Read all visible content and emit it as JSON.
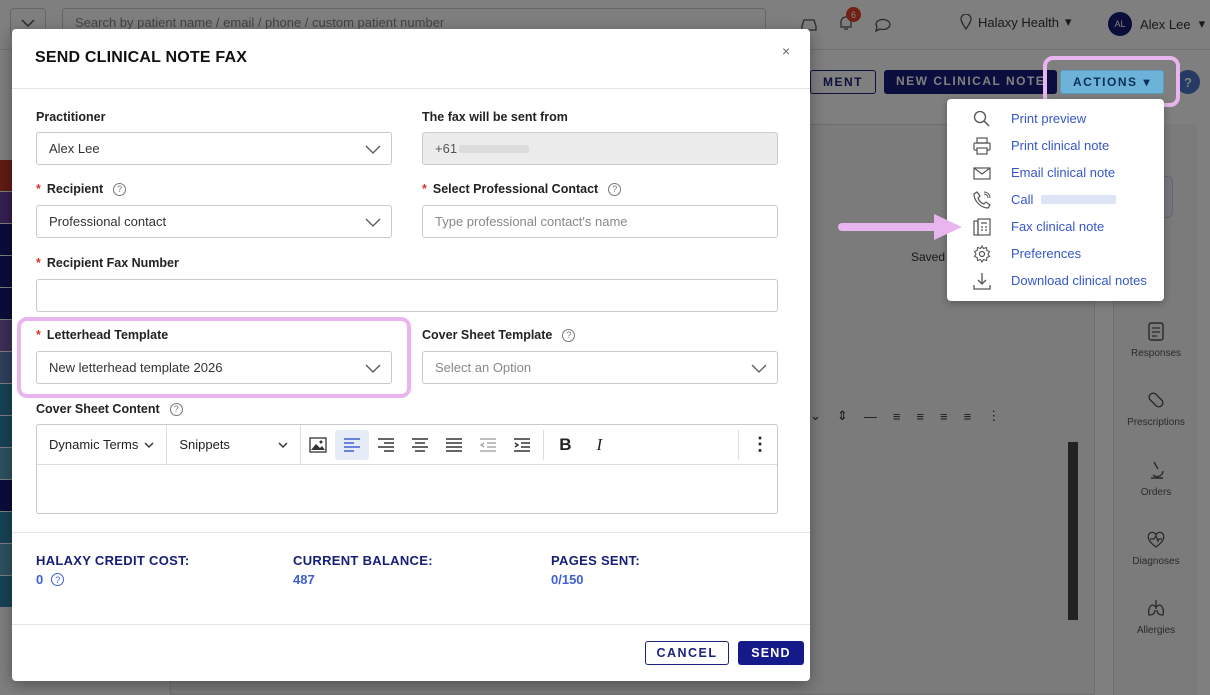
{
  "topbar": {
    "search_placeholder": "Search by patient name / email / phone / custom patient number",
    "notification_count": "6",
    "location": "Halaxy Health",
    "user_initials": "AL",
    "user_name": "Alex Lee"
  },
  "header": {
    "appointment_button": "MENT",
    "new_note_button": "NEW CLINICAL NOTE",
    "actions_button": "ACTIONS",
    "help_label": "?"
  },
  "background": {
    "saved_text": "Saved",
    "rail": [
      {
        "label": "Responses",
        "icon": "clipboard-icon"
      },
      {
        "label": "Prescriptions",
        "icon": "pill-icon"
      },
      {
        "label": "Orders",
        "icon": "microscope-icon"
      },
      {
        "label": "Diagnoses",
        "icon": "heart-pulse-icon"
      },
      {
        "label": "Allergies",
        "icon": "lungs-icon"
      }
    ]
  },
  "actions_menu": {
    "items": [
      {
        "label": "Print preview",
        "icon": "search-icon"
      },
      {
        "label": "Print clinical note",
        "icon": "printer-icon"
      },
      {
        "label": "Email clinical note",
        "icon": "envelope-icon"
      },
      {
        "label": "Call",
        "icon": "phone-icon"
      },
      {
        "label": "Fax clinical note",
        "icon": "fax-icon"
      },
      {
        "label": "Preferences",
        "icon": "gear-icon"
      },
      {
        "label": "Download clinical notes",
        "icon": "download-icon"
      }
    ]
  },
  "modal": {
    "title": "SEND CLINICAL NOTE FAX",
    "close": "×",
    "practitioner_label": "Practitioner",
    "practitioner_value": "Alex Lee",
    "fax_from_label": "The fax will be sent from",
    "fax_from_value": "+61",
    "recipient_label": "Recipient",
    "recipient_value": "Professional contact",
    "contact_label": "Select Professional Contact",
    "contact_placeholder": "Type professional contact's name",
    "fax_number_label": "Recipient Fax Number",
    "fax_number_value": "",
    "letterhead_label": "Letterhead Template",
    "letterhead_value": "New letterhead template 2026",
    "cover_sheet_label": "Cover Sheet Template",
    "cover_sheet_placeholder": "Select an Option",
    "cover_content_label": "Cover Sheet Content",
    "editor": {
      "dynamic_terms": "Dynamic Terms",
      "snippets": "Snippets",
      "bold": "B",
      "italic": "I",
      "more": "⋮"
    },
    "stats": {
      "credit_label": "HALAXY CREDIT COST:",
      "credit_value": "0",
      "balance_label": "CURRENT BALANCE:",
      "balance_value": "487",
      "pages_label": "PAGES SENT:",
      "pages_value": "0/150"
    },
    "cancel": "CANCEL",
    "send": "SEND"
  },
  "colors": {
    "brand_dark": "#151a7a",
    "link_blue": "#3657c7",
    "highlight_pink": "#e9b5ee",
    "required_red": "#d9342b"
  }
}
